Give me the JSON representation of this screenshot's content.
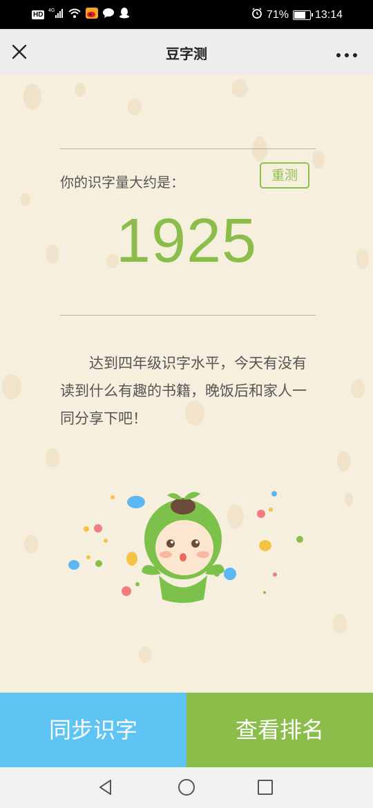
{
  "status_bar": {
    "hd": "HD",
    "network": "4G",
    "battery_percent": "71%",
    "battery_level": 0.71,
    "time": "13:14"
  },
  "nav": {
    "title": "豆字测",
    "close_icon": "close-icon",
    "more_icon": "more-icon"
  },
  "result": {
    "prompt": "你的识字量大约是：",
    "retest_label": "重测",
    "score": "1925",
    "message": "达到四年级识字水平，今天有没有读到什么有趣的书籍，晚饭后和家人一同分享下吧！"
  },
  "actions": {
    "sync_label": "同步识字",
    "ranking_label": "查看排名"
  },
  "colors": {
    "accent_green": "#8bbd4a",
    "accent_blue": "#5ec4f4",
    "background": "#f7efde"
  }
}
